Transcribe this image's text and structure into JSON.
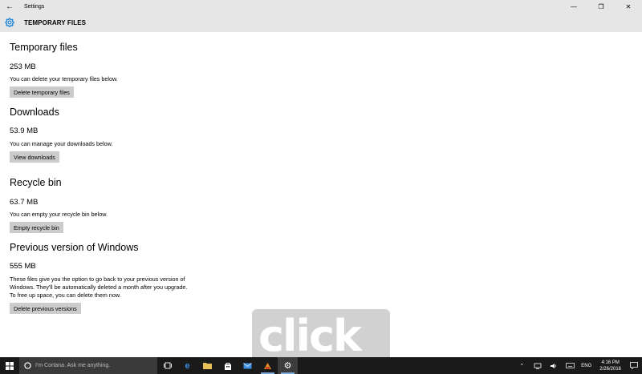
{
  "window": {
    "title": "Settings"
  },
  "header": {
    "title": "TEMPORARY FILES"
  },
  "sections": [
    {
      "title": "Temporary files",
      "size": "253 MB",
      "description": "You can delete your temporary files below.",
      "button": "Delete temporary files"
    },
    {
      "title": "Downloads",
      "size": "53.9 MB",
      "description": "You can manage your downloads below.",
      "button": "View downloads"
    },
    {
      "title": "Recycle bin",
      "size": "63.7 MB",
      "description": "You can empty your recycle bin below.",
      "button": "Empty recycle bin"
    },
    {
      "title": "Previous version of Windows",
      "size": "555 MB",
      "description": "These files give you the option to go back to your previous version of Windows. They'll be automatically deleted a month after you upgrade. To free up space, you can delete them now.",
      "button": "Delete previous versions"
    }
  ],
  "watermark": {
    "text": "click"
  },
  "taskbar": {
    "search_placeholder": "I'm Cortana. Ask me anything.",
    "language": "ENG",
    "time": "4:16 PM",
    "date": "2/26/2016"
  },
  "colors": {
    "chrome": "#e6e6e6",
    "button": "#cccccc",
    "taskbar": "#1a1a1a",
    "accent": "#0078d7"
  }
}
